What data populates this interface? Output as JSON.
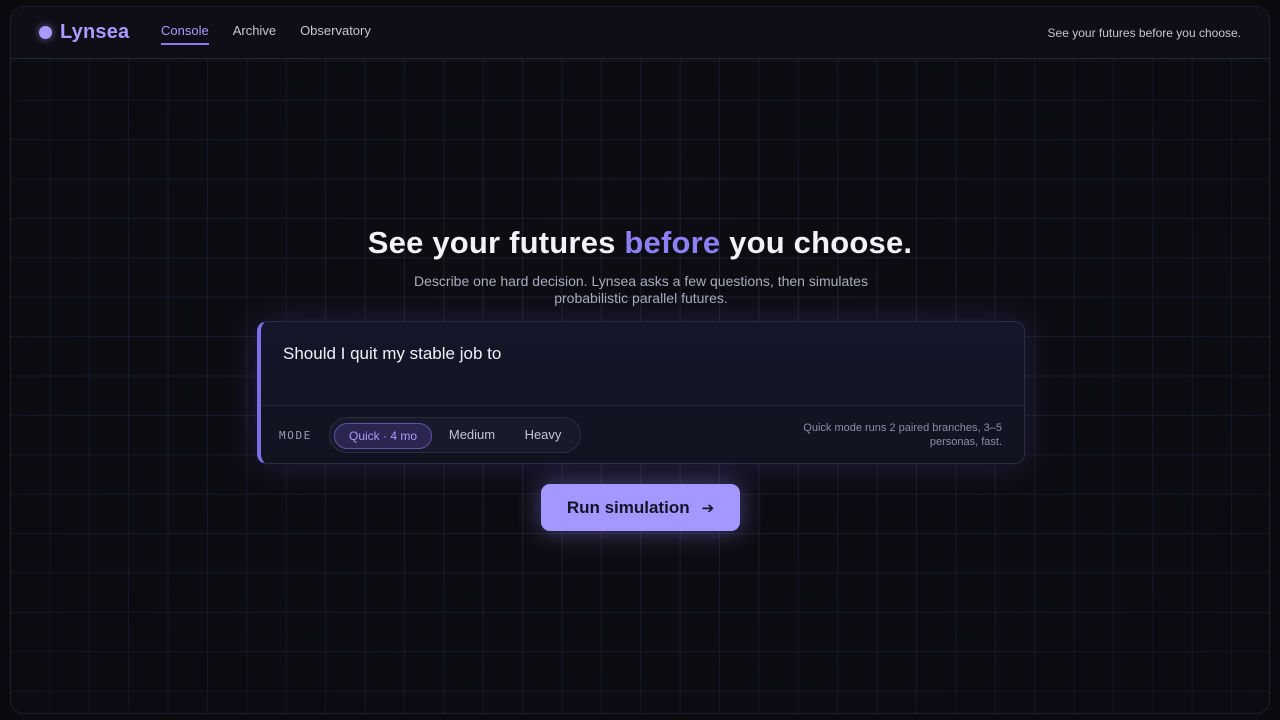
{
  "app": {
    "name": "Lynsea",
    "accent": "#a99bff"
  },
  "nav": [
    {
      "label": "Console",
      "active": true
    },
    {
      "label": "Archive",
      "active": false
    },
    {
      "label": "Observatory",
      "active": false
    }
  ],
  "header": {
    "tagline": "See your futures before you choose."
  },
  "hero": {
    "headline_pre": "See your futures ",
    "headline_accent": "before",
    "headline_post": " you choose.",
    "subtitle": "Describe one hard decision. Lynsea asks a few questions, then simulates probabilistic parallel futures."
  },
  "prompt": {
    "value": "Should I quit my stable job to",
    "mode_label": "MODE",
    "modes": [
      {
        "label": "Quick · 4 mo",
        "selected": true
      },
      {
        "label": "Medium",
        "selected": false
      },
      {
        "label": "Heavy",
        "selected": false
      }
    ],
    "hint": "Quick mode runs 2 paired branches, 3–5 personas, fast."
  },
  "run_button": {
    "label": "Run simulation",
    "icon": "arrow-right-icon"
  }
}
